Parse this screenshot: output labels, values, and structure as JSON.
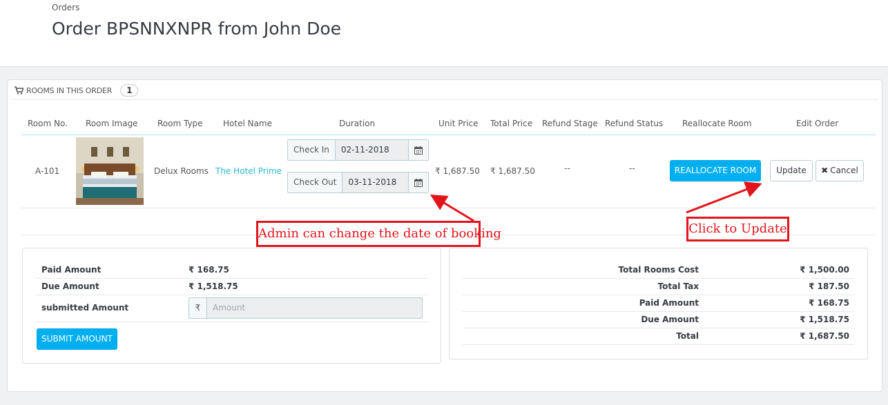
{
  "header": {
    "breadcrumb": "Orders",
    "title": "Order BPSNNXNPR from John Doe"
  },
  "rooms_panel": {
    "title": "ROOMS IN THIS ORDER",
    "count": "1",
    "columns": [
      "Room No.",
      "Room Image",
      "Room Type",
      "Hotel Name",
      "Duration",
      "Unit Price",
      "Total Price",
      "Refund Stage",
      "Refund Status",
      "Reallocate Room",
      "Edit Order"
    ],
    "row": {
      "room_no": "A-101",
      "room_type": "Delux Rooms",
      "hotel_name": "The Hotel Prime",
      "check_in_label": "Check In",
      "check_in_value": "02-11-2018",
      "check_out_label": "Check Out",
      "check_out_value": "03-11-2018",
      "unit_price": "₹ 1,687.50",
      "total_price": "₹ 1,687.50",
      "refund_stage": "--",
      "refund_status": "--",
      "reallocate_label": "REALLOCATE ROOM",
      "update_label": "Update",
      "cancel_label": "Cancel"
    }
  },
  "payment_box": {
    "paid_label": "Paid Amount",
    "paid_value": "₹ 168.75",
    "due_label": "Due Amount",
    "due_value": "₹ 1,518.75",
    "submitted_label": "submitted Amount",
    "currency_symbol": "₹",
    "amount_placeholder": "Amount",
    "submit_label": "SUBMIT AMOUNT"
  },
  "totals_box": {
    "rows": [
      {
        "label": "Total Rooms Cost",
        "value": "₹ 1,500.00"
      },
      {
        "label": "Total Tax",
        "value": "₹ 187.50"
      },
      {
        "label": "Paid Amount",
        "value": "₹ 168.75"
      },
      {
        "label": "Due Amount",
        "value": "₹ 1,518.75"
      },
      {
        "label": "Total",
        "value": "₹ 1,687.50"
      }
    ]
  },
  "annotations": {
    "date_note": "Admin can change the date of booking",
    "update_note": "Click to Update"
  },
  "colors": {
    "accent": "#00aff0",
    "annotation": "#e2141b",
    "link": "#25b9d7"
  }
}
